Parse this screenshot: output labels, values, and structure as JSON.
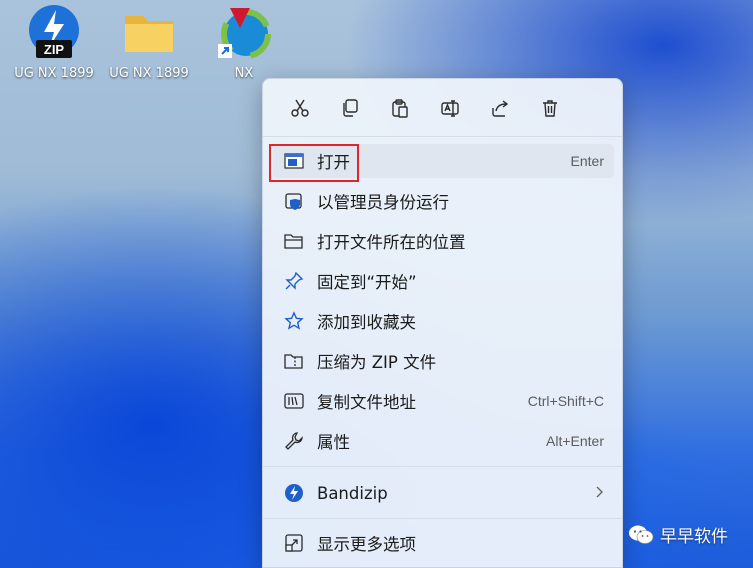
{
  "desktop": {
    "icons": [
      {
        "label": "UG NX 1899",
        "icon": "zip-archive-icon"
      },
      {
        "label": "UG NX 1899",
        "icon": "folder-icon"
      },
      {
        "label": "NX",
        "icon": "nx-app-shortcut-icon"
      }
    ],
    "zip_badge": "ZIP"
  },
  "context_menu": {
    "toolbar": [
      {
        "name": "cut",
        "icon": "scissors-icon"
      },
      {
        "name": "copy",
        "icon": "copy-icon"
      },
      {
        "name": "paste",
        "icon": "clipboard-icon"
      },
      {
        "name": "rename",
        "icon": "rename-icon"
      },
      {
        "name": "share",
        "icon": "share-icon"
      },
      {
        "name": "delete",
        "icon": "trash-icon"
      }
    ],
    "items": [
      {
        "label": "打开",
        "shortcut": "Enter",
        "icon": "open-window-icon"
      },
      {
        "label": "以管理员身份运行",
        "shortcut": "",
        "icon": "shield-icon"
      },
      {
        "label": "打开文件所在的位置",
        "shortcut": "",
        "icon": "folder-outline-icon"
      },
      {
        "label": "固定到“开始”",
        "shortcut": "",
        "icon": "pin-icon"
      },
      {
        "label": "添加到收藏夹",
        "shortcut": "",
        "icon": "star-icon"
      },
      {
        "label": "压缩为 ZIP 文件",
        "shortcut": "",
        "icon": "zip-folder-icon"
      },
      {
        "label": "复制文件地址",
        "shortcut": "Ctrl+Shift+C",
        "icon": "copy-path-icon"
      },
      {
        "label": "属性",
        "shortcut": "Alt+Enter",
        "icon": "wrench-icon"
      }
    ],
    "bandizip": {
      "label": "Bandizip",
      "icon": "bandizip-icon"
    },
    "more": {
      "label": "显示更多选项",
      "icon": "more-options-icon"
    }
  },
  "watermark": {
    "label": "早早软件",
    "icon": "wechat-icon"
  },
  "colors": {
    "highlight_border": "#e0262d",
    "accent": "#0067c0",
    "menu_bg": "#ecf2fa"
  }
}
